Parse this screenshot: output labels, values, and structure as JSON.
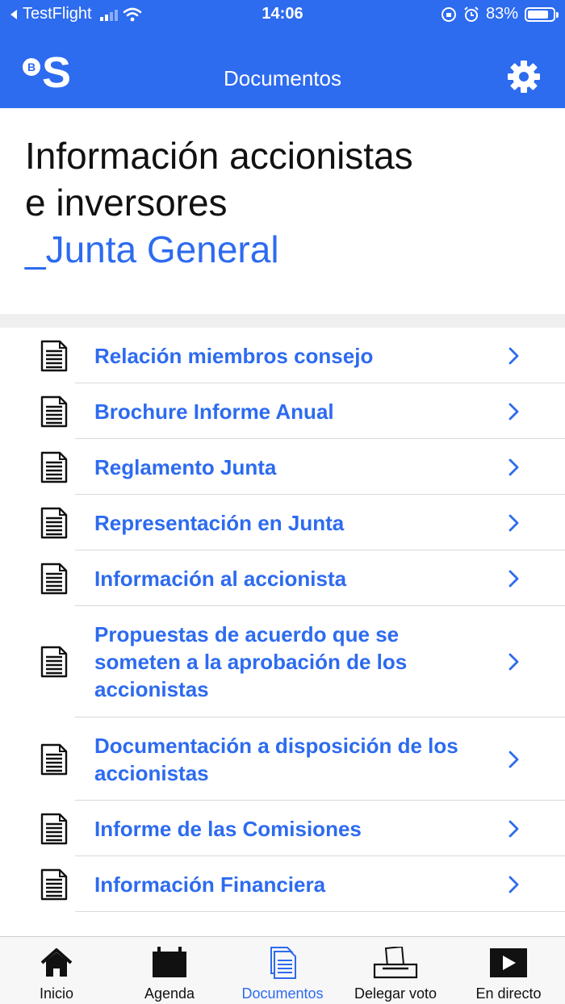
{
  "status_bar": {
    "back_app": "TestFlight",
    "time": "14:06",
    "battery": "83%",
    "battery_level": 0.83
  },
  "nav": {
    "logo_letter_b": "B",
    "logo_letter_s": "S",
    "title": "Documentos",
    "settings_icon": "gear-icon"
  },
  "header": {
    "title_line1": "Información accionistas",
    "title_line2": "e inversores",
    "subtitle": "_Junta General"
  },
  "documents": [
    {
      "label": "Relación miembros consejo",
      "icon": "document-icon"
    },
    {
      "label": "Brochure Informe Anual",
      "icon": "document-icon"
    },
    {
      "label": "Reglamento Junta",
      "icon": "document-icon"
    },
    {
      "label": "Representación en Junta",
      "icon": "document-icon"
    },
    {
      "label": "Información al accionista",
      "icon": "document-icon"
    },
    {
      "label": "Propuestas de acuerdo que se someten a la aprobación de los accionistas",
      "icon": "document-icon"
    },
    {
      "label": "Documentación a disposición de los accionistas",
      "icon": "document-icon"
    },
    {
      "label": "Informe de las Comisiones",
      "icon": "document-icon"
    },
    {
      "label": "Información Financiera",
      "icon": "document-icon"
    }
  ],
  "tabs": [
    {
      "label": "Inicio",
      "icon": "home-icon",
      "active": false
    },
    {
      "label": "Agenda",
      "icon": "calendar-icon",
      "active": false
    },
    {
      "label": "Documentos",
      "icon": "documents-icon",
      "active": true
    },
    {
      "label": "Delegar voto",
      "icon": "ballot-icon",
      "active": false
    },
    {
      "label": "En directo",
      "icon": "play-icon",
      "active": false
    }
  ],
  "colors": {
    "brand_blue": "#2d6bef",
    "text_dark": "#111111",
    "divider": "#d9d9d9"
  }
}
